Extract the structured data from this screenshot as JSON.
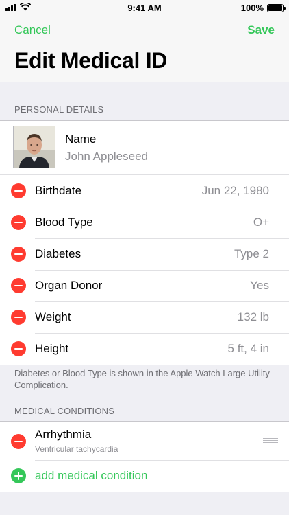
{
  "status_bar": {
    "time": "9:41 AM",
    "battery_percent": "100%",
    "signal_icon": "signal-bars-icon",
    "wifi_icon": "wifi-icon",
    "battery_icon": "battery-full-icon"
  },
  "nav": {
    "cancel_label": "Cancel",
    "save_label": "Save",
    "title": "Edit Medical ID",
    "accent_color": "#34c759"
  },
  "personal_details": {
    "header": "PERSONAL DETAILS",
    "name_label": "Name",
    "name_value": "John Appleseed",
    "rows": [
      {
        "label": "Birthdate",
        "value": "Jun 22, 1980"
      },
      {
        "label": "Blood Type",
        "value": "O+"
      },
      {
        "label": "Diabetes",
        "value": "Type 2"
      },
      {
        "label": "Organ Donor",
        "value": "Yes"
      },
      {
        "label": "Weight",
        "value": "132 lb"
      },
      {
        "label": "Height",
        "value": "5 ft, 4 in"
      }
    ],
    "footer_note": "Diabetes or Blood Type is shown in the Apple Watch Large Utility Complication."
  },
  "medical_conditions": {
    "header": "MEDICAL CONDITIONS",
    "items": [
      {
        "label": "Arrhythmia",
        "subtitle": "Ventricular tachycardia"
      }
    ],
    "add_label": "add medical condition"
  },
  "colors": {
    "delete": "#ff3b30",
    "add": "#34c759",
    "background": "#efeff4"
  }
}
